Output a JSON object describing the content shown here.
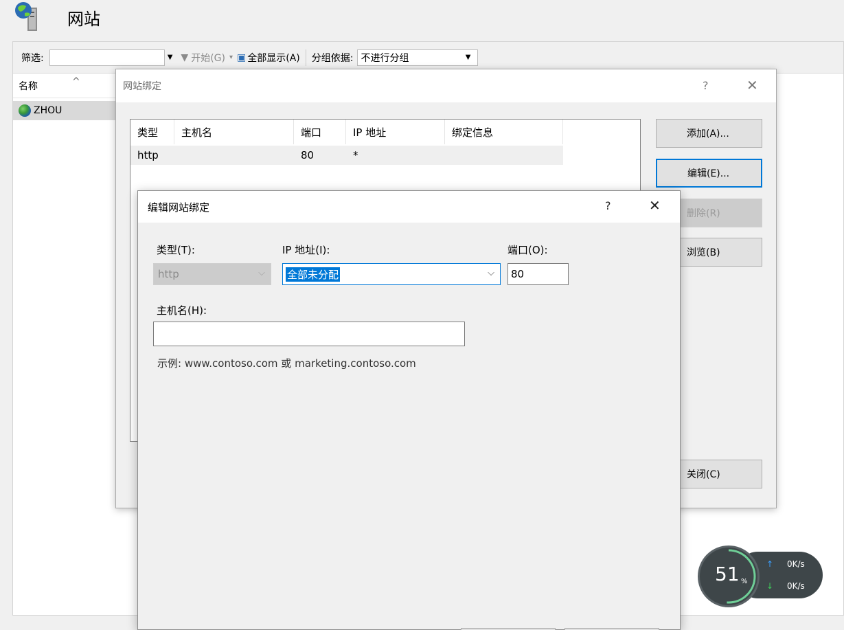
{
  "main": {
    "title": "网站",
    "toolbar": {
      "filter_label": "筛选:",
      "start_label": "开始(G)",
      "show_all_label": "全部显示(A)",
      "group_by_label": "分组依据:",
      "group_by_value": "不进行分组"
    },
    "list": {
      "column_name": "名称",
      "rows": [
        "ZHOU"
      ]
    }
  },
  "bindings_dialog": {
    "title": "网站绑定",
    "help": "?",
    "columns": [
      "类型",
      "主机名",
      "端口",
      "IP 地址",
      "绑定信息"
    ],
    "rows": [
      {
        "type": "http",
        "host": "",
        "port": "80",
        "ip": "*",
        "info": ""
      }
    ],
    "buttons": {
      "add": "添加(A)...",
      "edit": "编辑(E)...",
      "remove": "删除(R)",
      "browse": "浏览(B)",
      "close": "关闭(C)"
    }
  },
  "edit_dialog": {
    "title": "编辑网站绑定",
    "help": "?",
    "type_label": "类型(T):",
    "type_value": "http",
    "ip_label": "IP 地址(I):",
    "ip_value": "全部未分配",
    "port_label": "端口(O):",
    "port_value": "80",
    "hostname_label": "主机名(H):",
    "hostname_value": "",
    "example": "示例: www.contoso.com 或 marketing.contoso.com"
  },
  "net_widget": {
    "cpu_percent": "51",
    "percent_sign": "%",
    "upload_rate": "0K/s",
    "download_rate": "0K/s",
    "colors": {
      "up": "#3aa0ff",
      "down": "#3ecf5a",
      "ring": "#6fcf97"
    }
  }
}
